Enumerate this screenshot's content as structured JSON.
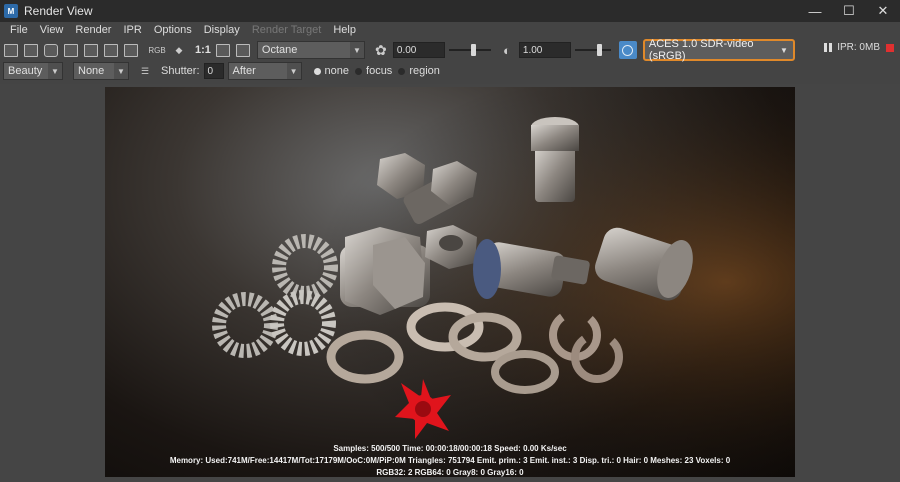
{
  "window": {
    "title": "Render View",
    "app_icon": "maya-icon"
  },
  "menu": [
    "File",
    "View",
    "Render",
    "IPR",
    "Options",
    "Display",
    "Render Target",
    "Help"
  ],
  "toolbar": {
    "one_to_one": "1:1",
    "rgb_label": "RGB",
    "renderer": "Octane",
    "exposure": "0.00",
    "gamma": "1.00",
    "exposure_level": 0.6,
    "gamma_level": 0.7,
    "colorspace": "ACES 1.0 SDR-video (sRGB)",
    "colorspace_accent": "#e0892a",
    "ipr_status": "IPR: 0MB"
  },
  "toolbar2": {
    "pass": "Beauty",
    "pass2": "None",
    "shutter_label": "Shutter:",
    "shutter_value": "0",
    "shutter_mode": "After",
    "radio_none": "none",
    "radio_focus": "focus",
    "radio_region": "region"
  },
  "stats": {
    "line1": "Samples: 500/500 Time: 00:00:18/00:00:18 Speed: 0.00 Ks/sec",
    "line2": "Memory: Used:741M/Free:14417M/Tot:17179M/OoC:0M/PiP:0M Triangles: 751794 Emit. prim.: 3 Emit. inst.: 3 Disp. tri.: 0 Hair: 0 Meshes: 23 Voxels: 0",
    "line3": "RGB32: 2 RGB64: 0 Gray8: 0 Gray16: 0"
  }
}
